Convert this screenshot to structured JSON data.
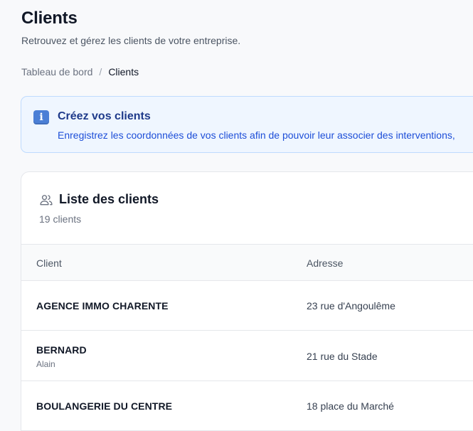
{
  "header": {
    "title": "Clients",
    "subtitle": "Retrouvez et gérez les clients de votre entreprise."
  },
  "breadcrumb": {
    "items": [
      "Tableau de bord",
      "Clients"
    ],
    "separator": "/"
  },
  "info_banner": {
    "icon": "info-icon",
    "icon_glyph": "i",
    "title": "Créez vos clients",
    "text": "Enregistrez les coordonnées de vos clients afin de pouvoir leur associer des interventions,"
  },
  "clients_card": {
    "icon": "users-icon",
    "title": "Liste des clients",
    "count": "19 clients",
    "columns": [
      "Client",
      "Adresse"
    ],
    "rows": [
      {
        "name": "AGENCE IMMO CHARENTE",
        "sub": "",
        "address": "23 rue d'Angoulême"
      },
      {
        "name": "BERNARD",
        "sub": "Alain",
        "address": "21 rue du Stade"
      },
      {
        "name": "BOULANGERIE DU CENTRE",
        "sub": "",
        "address": "18 place du Marché"
      }
    ]
  },
  "colors": {
    "background": "#f8f9fb",
    "banner_bg": "#eff6ff",
    "banner_border": "#bfdbfe",
    "banner_title": "#1e3a8a",
    "banner_text": "#1d4ed8",
    "info_icon": "#4b7fd6"
  }
}
